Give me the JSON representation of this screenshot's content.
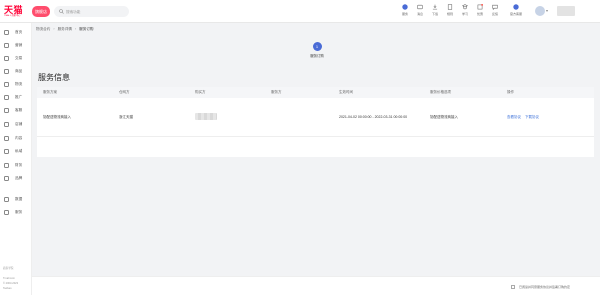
{
  "brand": {
    "logo_text": "天猫",
    "logo_sub": "TMALL 商家中心",
    "store_label": "旗舰店"
  },
  "search": {
    "placeholder": "搜索功能"
  },
  "toolbar": {
    "items": [
      {
        "label": "服务",
        "icon": "service-icon"
      },
      {
        "label": "消息",
        "icon": "message-icon"
      },
      {
        "label": "下载",
        "icon": "download-icon"
      },
      {
        "label": "规则",
        "icon": "rules-icon"
      },
      {
        "label": "学习",
        "icon": "study-icon"
      },
      {
        "label": "优惠",
        "icon": "discount-icon"
      },
      {
        "label": "反馈",
        "icon": "feedback-icon"
      },
      {
        "label": "官方客服",
        "icon": "support-icon"
      }
    ],
    "accent": "#4a6bd6"
  },
  "sidebar": {
    "items": [
      {
        "label": "首页",
        "icon": "home-icon"
      },
      {
        "label": "营销",
        "icon": "marketing-icon"
      },
      {
        "label": "交易",
        "icon": "trade-icon"
      },
      {
        "label": "商品",
        "icon": "goods-icon"
      },
      {
        "label": "物流",
        "icon": "logistics-icon"
      },
      {
        "label": "推广",
        "icon": "promotion-icon"
      },
      {
        "label": "客服",
        "icon": "customer-service-icon"
      },
      {
        "label": "店铺",
        "icon": "store-icon"
      },
      {
        "label": "内容",
        "icon": "content-icon"
      },
      {
        "label": "私域",
        "icon": "private-domain-icon"
      },
      {
        "label": "财务",
        "icon": "finance-icon"
      },
      {
        "label": "品牌",
        "icon": "brand-icon"
      },
      {
        "label": "数据",
        "icon": "data-icon"
      },
      {
        "label": "服务",
        "icon": "service-icon"
      }
    ],
    "footer_links": [
      "商家学院",
      "Tmall.com",
      "© 2003-2023",
      "Taobao"
    ]
  },
  "breadcrumb": {
    "items": [
      "物流合约",
      "服务详情",
      "服务订购"
    ]
  },
  "step": {
    "number": "1",
    "label": "服务订购"
  },
  "section_title": "服务信息",
  "table": {
    "headers": [
      "服务方案",
      "仓网方",
      "购买方",
      "服务方",
      "生效时间",
      "服务价格选项",
      "操作"
    ],
    "rows": [
      {
        "plan": "协配送物流商接入",
        "warehouse": "浙江天猫",
        "buyer_blurred": true,
        "provider": "",
        "effective": "2021-04-02 00:00:00 - 2022-03-31 00:00:00",
        "price_option": "协配送物流商接入",
        "actions": [
          "查看协议",
          "下载协议"
        ]
      }
    ]
  },
  "footer": {
    "agreement_text": "已阅读并同意服务协议并签署订购约定"
  }
}
